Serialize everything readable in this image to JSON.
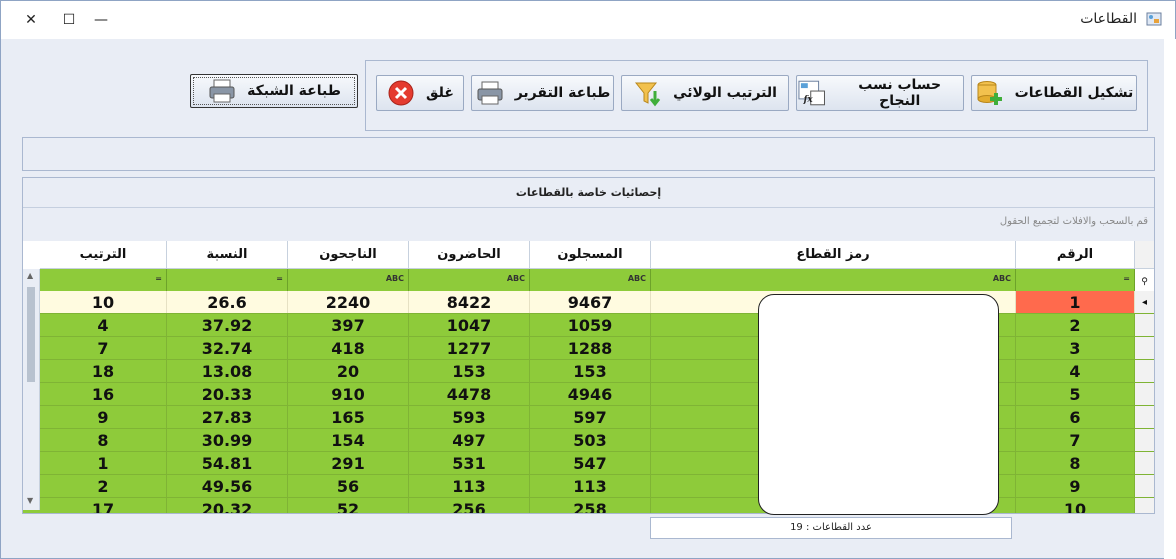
{
  "window": {
    "title": "القطاعات",
    "controls": {
      "close": "✕",
      "maximize": "☐",
      "minimize": "—"
    }
  },
  "toolbar": {
    "form_sectors": "تشكيل القطاعات",
    "calc_success": "حساب نسب النجاح",
    "wilaya_rank": "الترتيب الولائي",
    "print_report": "طباعة التقرير",
    "close": "غلق",
    "print_grid": "طباعة الشبكة"
  },
  "grid": {
    "caption": "إحصائيات خاصة بالقطاعات",
    "group_hint": "قم بالسحب والافلات لتجميع الحقول",
    "columns": {
      "num": "الرقم",
      "code": "رمز القطاع",
      "registered": "المسجلون",
      "present": "الحاضرون",
      "passed": "الناجحون",
      "ratio": "النسبة",
      "rank": "الترتيب"
    },
    "filter_icons": {
      "eq": "=",
      "abc": "ABC"
    },
    "rows": [
      {
        "num": "1",
        "registered": "9467",
        "present": "8422",
        "passed": "2240",
        "ratio": "26.6",
        "rank": "10"
      },
      {
        "num": "2",
        "registered": "1059",
        "present": "1047",
        "passed": "397",
        "ratio": "37.92",
        "rank": "4"
      },
      {
        "num": "3",
        "registered": "1288",
        "present": "1277",
        "passed": "418",
        "ratio": "32.74",
        "rank": "7"
      },
      {
        "num": "4",
        "registered": "153",
        "present": "153",
        "passed": "20",
        "ratio": "13.08",
        "rank": "18"
      },
      {
        "num": "5",
        "registered": "4946",
        "present": "4478",
        "passed": "910",
        "ratio": "20.33",
        "rank": "16"
      },
      {
        "num": "6",
        "registered": "597",
        "present": "593",
        "passed": "165",
        "ratio": "27.83",
        "rank": "9"
      },
      {
        "num": "7",
        "registered": "503",
        "present": "497",
        "passed": "154",
        "ratio": "30.99",
        "rank": "8"
      },
      {
        "num": "8",
        "registered": "547",
        "present": "531",
        "passed": "291",
        "ratio": "54.81",
        "rank": "1"
      },
      {
        "num": "9",
        "registered": "113",
        "present": "113",
        "passed": "56",
        "ratio": "49.56",
        "rank": "2"
      },
      {
        "num": "10",
        "registered": "258",
        "present": "256",
        "passed": "52",
        "ratio": "20.32",
        "rank": "17"
      }
    ]
  },
  "footer": {
    "count_text": "عدد القطاعات : 19"
  },
  "colors": {
    "row_green": "#8ecb3a",
    "current_row": "#fffbe0",
    "current_cell": "#ff6a4d"
  }
}
